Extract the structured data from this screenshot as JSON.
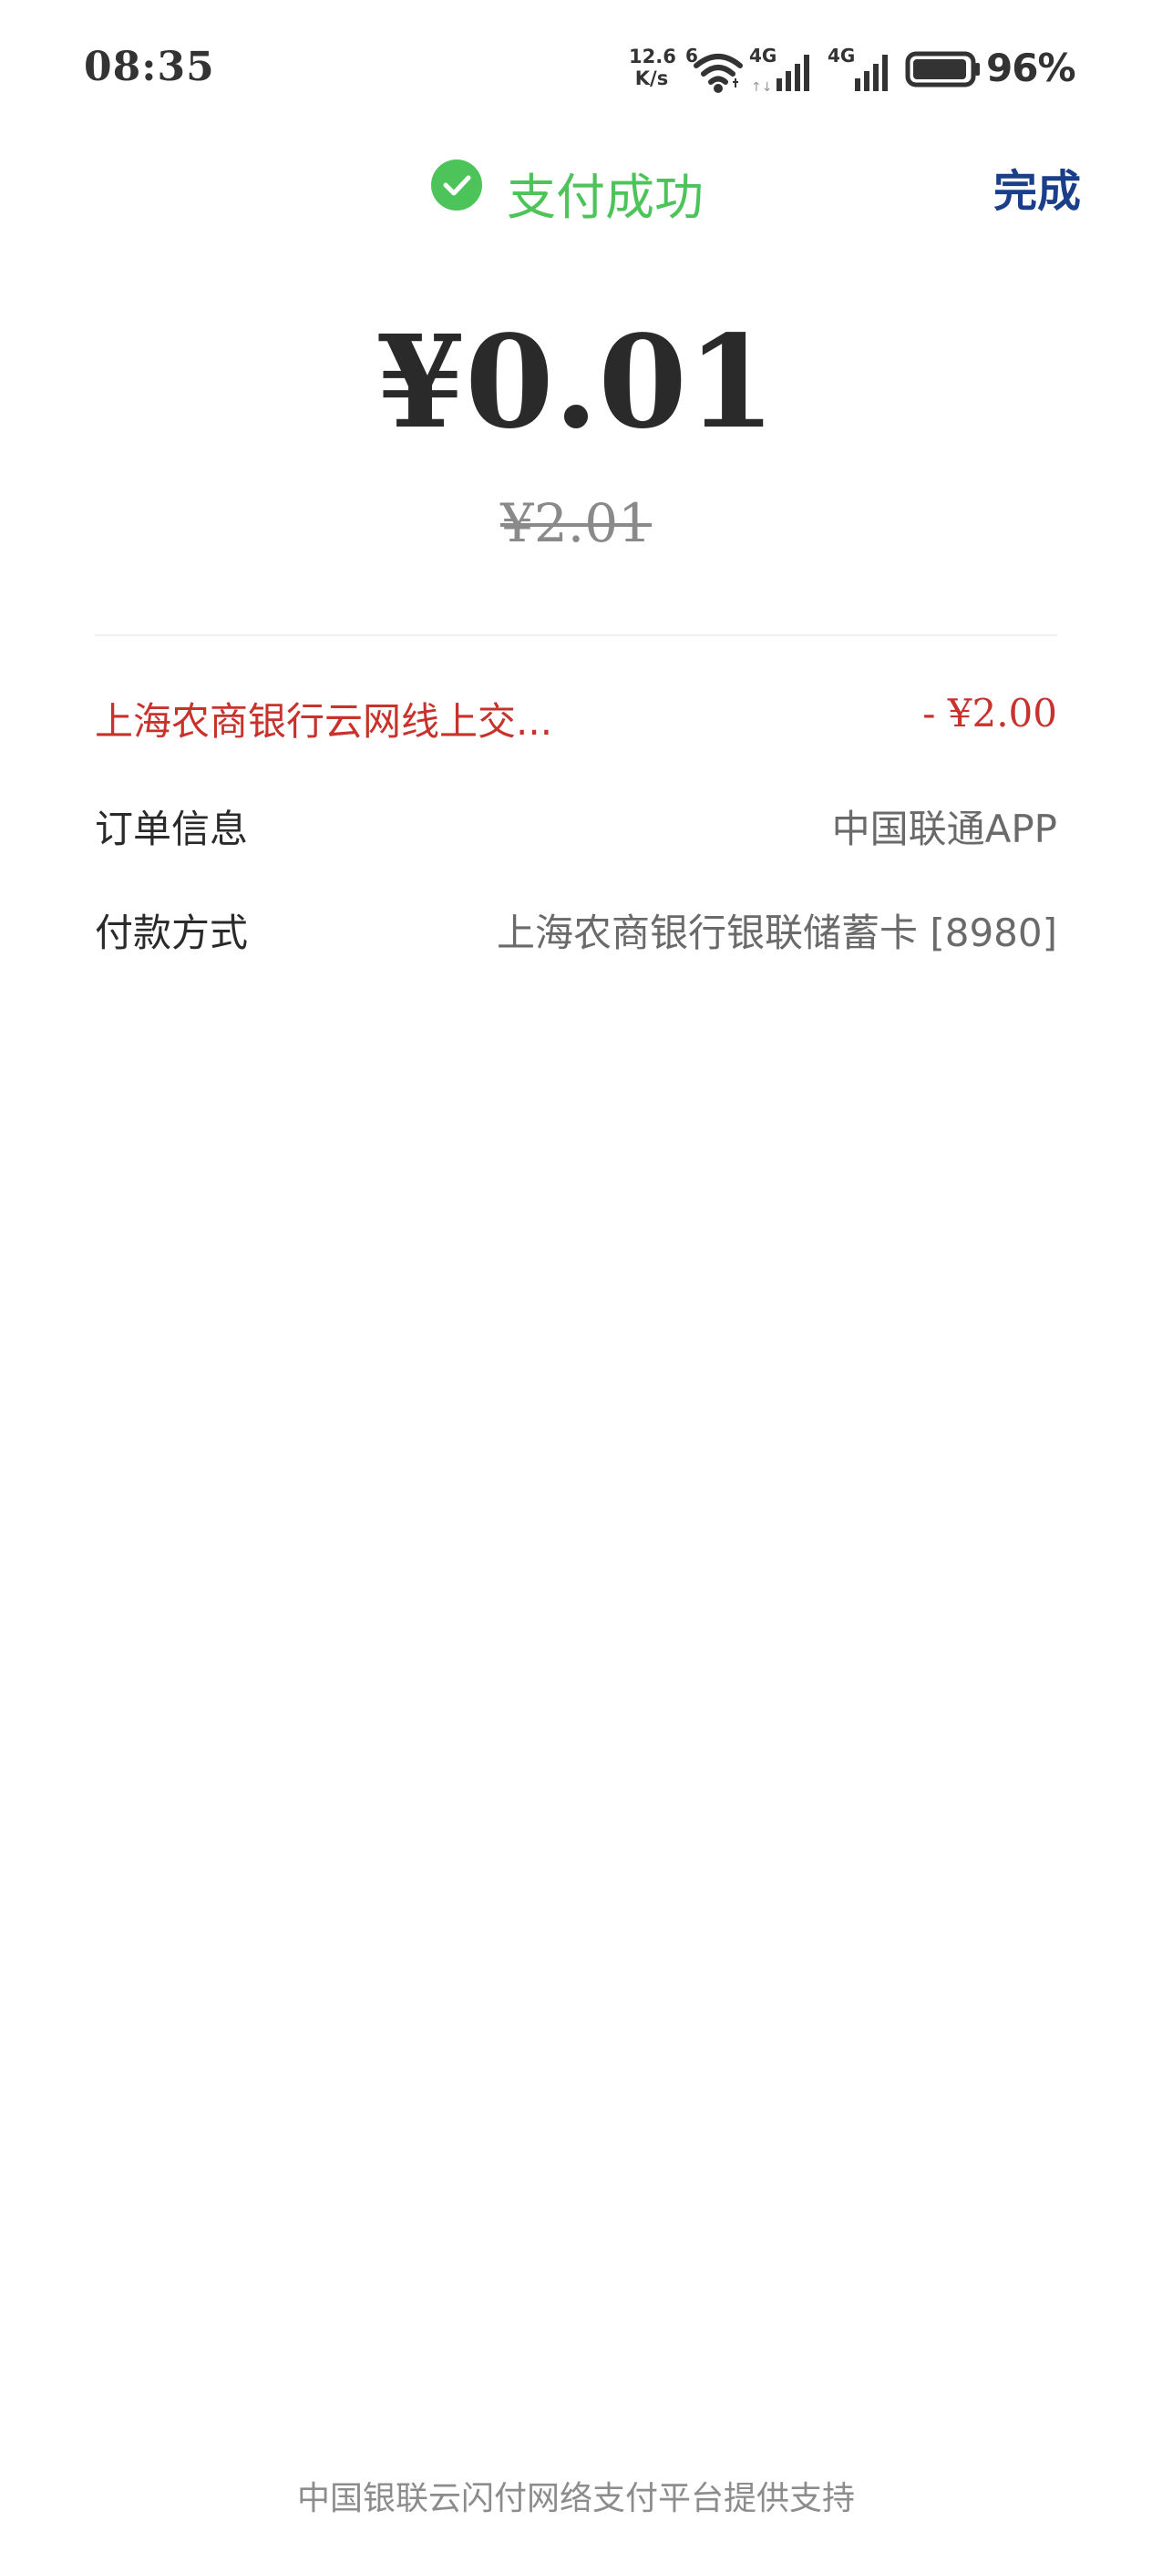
{
  "status_bar": {
    "time": "08:35",
    "net_speed_value": "12.6",
    "net_speed_unit": "K/s",
    "wifi_label": "6",
    "signal1_label": "4G",
    "signal2_label": "4G",
    "battery_percent": "96%",
    "battery_level": 0.96
  },
  "header": {
    "title": "支付成功",
    "done_label": "完成",
    "icon": "check-circle-icon",
    "accent_color": "#4cc45a"
  },
  "payment": {
    "amount": "¥0.01",
    "original_amount": "¥2.01"
  },
  "details": [
    {
      "label": "上海农商银行云网线上交...",
      "value": "- ¥2.00"
    },
    {
      "label": "订单信息",
      "value": "中国联通APP"
    },
    {
      "label": "付款方式",
      "value": "上海农商银行银联储蓄卡 [8980]"
    }
  ],
  "footer": {
    "text": "中国银联云闪付网络支付平台提供支持"
  }
}
